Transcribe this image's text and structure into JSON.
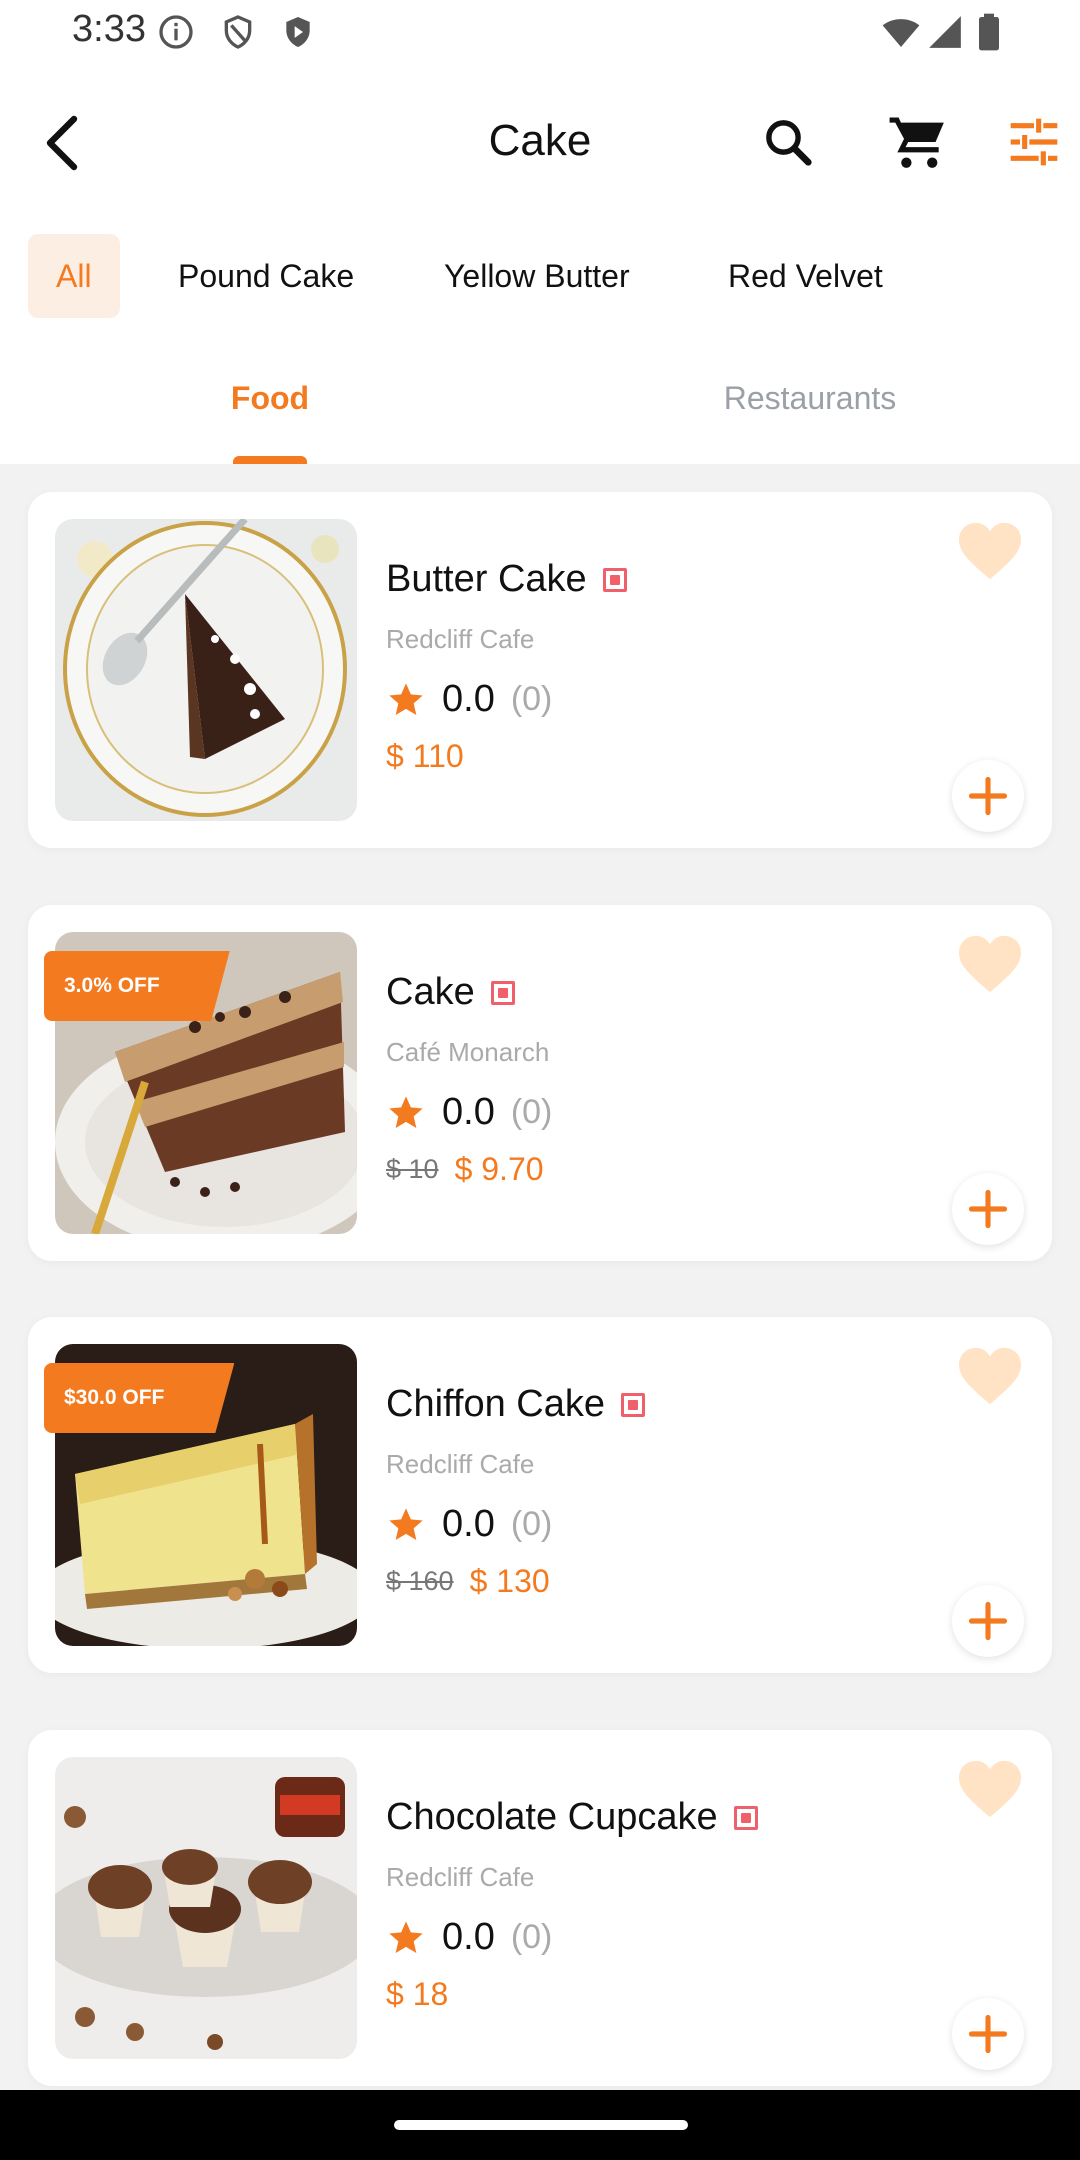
{
  "status_bar": {
    "time": "3:33",
    "icons": [
      "info-icon",
      "shield-icon",
      "play-protect-icon",
      "wifi-icon",
      "signal-icon",
      "battery-icon"
    ]
  },
  "app_bar": {
    "title": "Cake",
    "back_icon": "back-arrow-icon",
    "search_icon": "search-icon",
    "cart_icon": "cart-icon",
    "filter_icon": "filter-sliders-icon"
  },
  "categories": [
    {
      "label": "All",
      "active": true
    },
    {
      "label": "Pound Cake",
      "active": false
    },
    {
      "label": "Yellow Butter",
      "active": false
    },
    {
      "label": "Red Velvet",
      "active": false
    }
  ],
  "tabs": [
    {
      "label": "Food",
      "active": true
    },
    {
      "label": "Restaurants",
      "active": false
    }
  ],
  "items": [
    {
      "title": "Butter Cake",
      "restaurant": "Redcliff Cafe",
      "rating": "0.0",
      "rating_count": "(0)",
      "old_price": "",
      "price": "$ 110",
      "discount": ""
    },
    {
      "title": "Cake",
      "restaurant": "Café Monarch",
      "rating": "0.0",
      "rating_count": "(0)",
      "old_price": "$ 10",
      "price": "$ 9.70",
      "discount": "3.0% OFF"
    },
    {
      "title": "Chiffon Cake",
      "restaurant": "Redcliff Cafe",
      "rating": "0.0",
      "rating_count": "(0)",
      "old_price": "$ 160",
      "price": "$ 130",
      "discount": "$30.0 OFF"
    },
    {
      "title": "Chocolate Cupcake",
      "restaurant": "Redcliff Cafe",
      "rating": "0.0",
      "rating_count": "(0)",
      "old_price": "",
      "price": "$ 18",
      "discount": ""
    }
  ],
  "colors": {
    "accent": "#f47a1f",
    "accent_light": "#fdeee3",
    "favorite": "#ffe3c4",
    "veg_mark": "#f0606a",
    "muted_text": "#aaaaaa"
  }
}
